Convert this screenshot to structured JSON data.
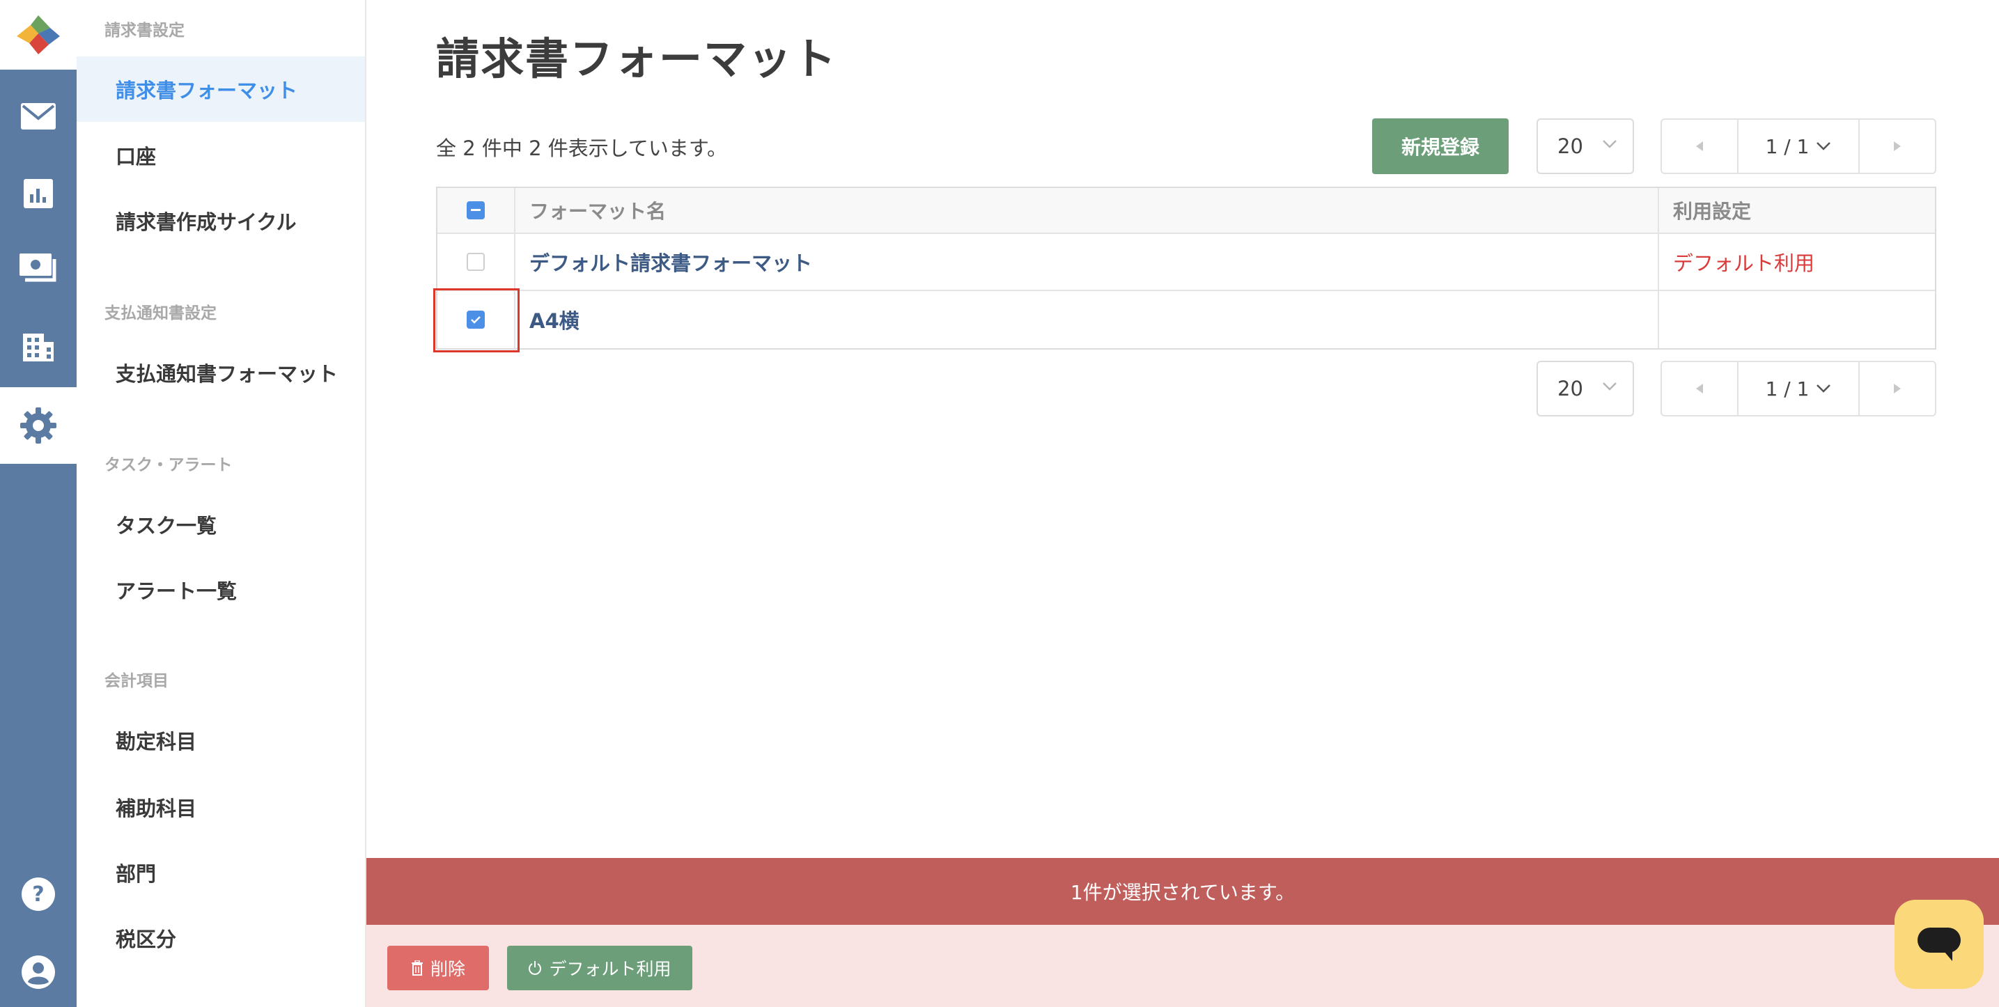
{
  "nav_rail": {
    "items": [
      {
        "icon": "logo-icon"
      },
      {
        "icon": "mail-icon"
      },
      {
        "icon": "report-chart-icon"
      },
      {
        "icon": "payment-icon"
      },
      {
        "icon": "building-icon"
      },
      {
        "icon": "gear-icon",
        "active": true
      },
      {
        "icon": "help-icon"
      },
      {
        "icon": "user-account-icon"
      }
    ]
  },
  "sidebar": {
    "sections": [
      {
        "label": "請求書設定",
        "items": [
          "請求書フォーマット",
          "口座",
          "請求書作成サイクル"
        ]
      },
      {
        "label": "支払通知書設定",
        "items": [
          "支払通知書フォーマット"
        ]
      },
      {
        "label": "タスク・アラート",
        "items": [
          "タスク一覧",
          "アラート一覧"
        ]
      },
      {
        "label": "会計項目",
        "items": [
          "勘定科目",
          "補助科目",
          "部門",
          "税区分"
        ]
      }
    ],
    "active_item": "請求書フォーマット"
  },
  "page": {
    "title": "請求書フォーマット",
    "count_text": "全 2 件中 2 件表示しています。",
    "new_button": "新規登録",
    "page_size": "20",
    "pager_label": "1 / 1"
  },
  "table": {
    "headers": {
      "name": "フォーマット名",
      "usage": "利用設定"
    },
    "rows": [
      {
        "name": "デフォルト請求書フォーマット",
        "usage": "デフォルト利用",
        "checked": false
      },
      {
        "name": "A4横",
        "usage": "",
        "checked": true
      }
    ]
  },
  "selection_bar": {
    "text": "1件が選択されています。"
  },
  "actions": {
    "delete": "削除",
    "set_default": "デフォルト利用"
  },
  "colors": {
    "rail": "#5b7ba3",
    "accent_blue": "#3f8ee8",
    "primary_green": "#6b9e79",
    "danger_red": "#d93a3a",
    "selection_bar": "#c05e5c",
    "chat_button": "#fbd97b"
  }
}
